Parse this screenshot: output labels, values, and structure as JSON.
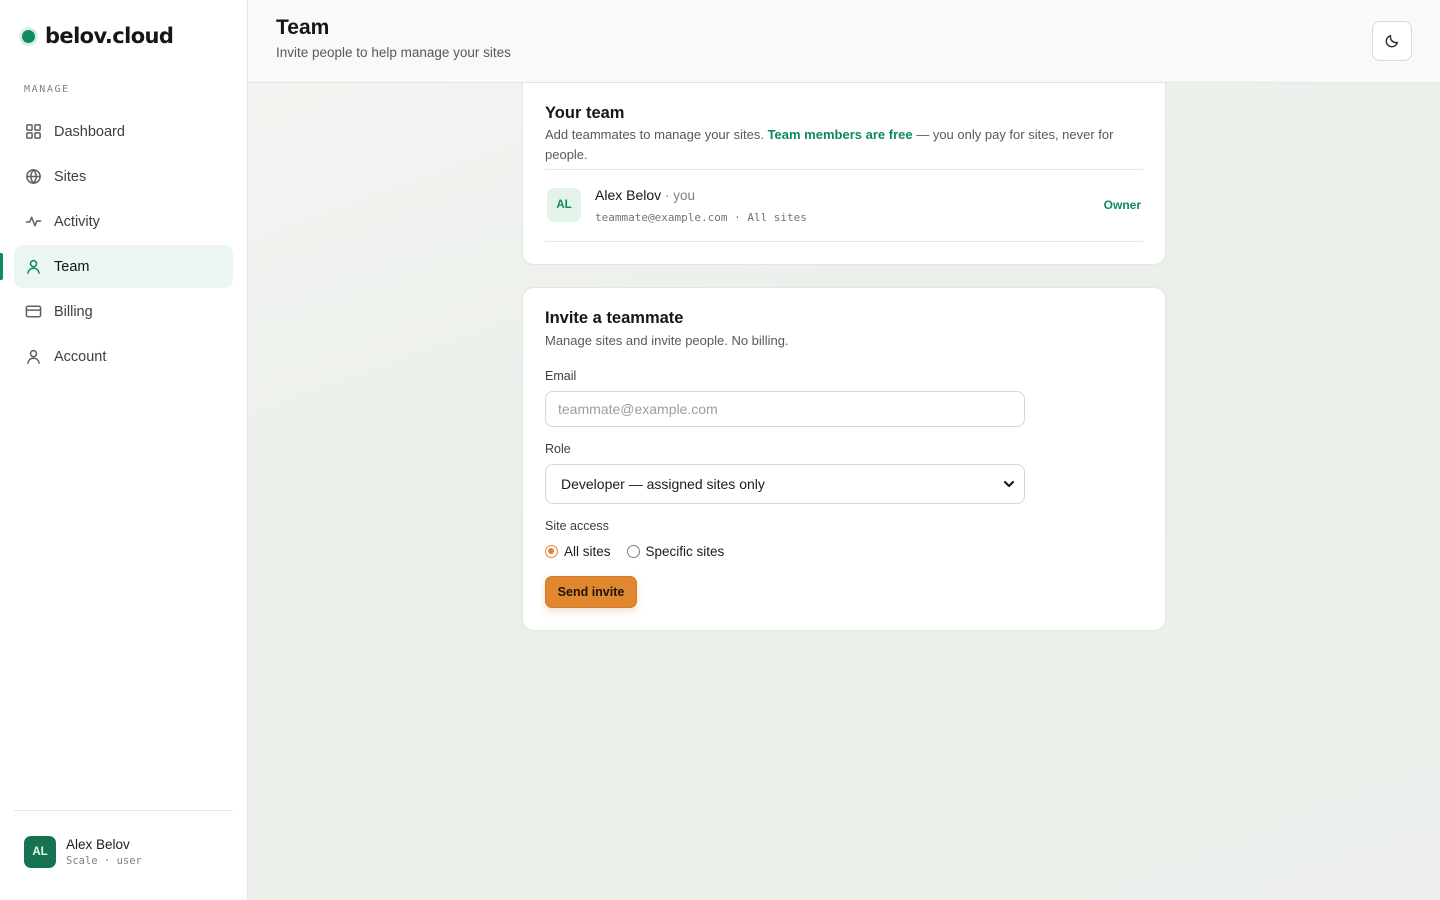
{
  "brand": {
    "name": "belov.cloud",
    "accent": "#0f8a5f"
  },
  "sidebar": {
    "section_label": "MANAGE",
    "items": [
      {
        "label": "Dashboard",
        "icon": "dashboard-icon",
        "active": false
      },
      {
        "label": "Sites",
        "icon": "globe-icon",
        "active": false
      },
      {
        "label": "Activity",
        "icon": "activity-icon",
        "active": false
      },
      {
        "label": "Team",
        "icon": "user-icon",
        "active": true
      },
      {
        "label": "Billing",
        "icon": "credit-card-icon",
        "active": false
      },
      {
        "label": "Account",
        "icon": "user-icon",
        "active": false
      }
    ],
    "user": {
      "initials": "AL",
      "name": "Alex Belov",
      "plan": "Scale · user"
    }
  },
  "header": {
    "title": "Team",
    "subtitle": "Invite people to help manage your sites",
    "theme_toggle_icon": "moon-icon"
  },
  "team_card": {
    "title": "Your team",
    "desc_prefix": "Add teammates to manage your sites.",
    "desc_highlight": "Team members are free",
    "desc_suffix": "— you only pay for sites, never for people.",
    "members": [
      {
        "initials": "AL",
        "name": "Alex Belov",
        "you_suffix": "· you",
        "meta": "teammate@example.com · All sites",
        "role": "Owner"
      }
    ]
  },
  "invite_card": {
    "title": "Invite a teammate",
    "desc": "Manage sites and invite people. No billing.",
    "email_label": "Email",
    "email_placeholder": "teammate@example.com",
    "email_value": "",
    "role_label": "Role",
    "role_selected": "Developer — assigned sites only",
    "access_label": "Site access",
    "access_options": [
      {
        "label": "All sites",
        "checked": true
      },
      {
        "label": "Specific sites",
        "checked": false
      }
    ],
    "submit_label": "Send invite",
    "submit_color": "#e0872f"
  }
}
